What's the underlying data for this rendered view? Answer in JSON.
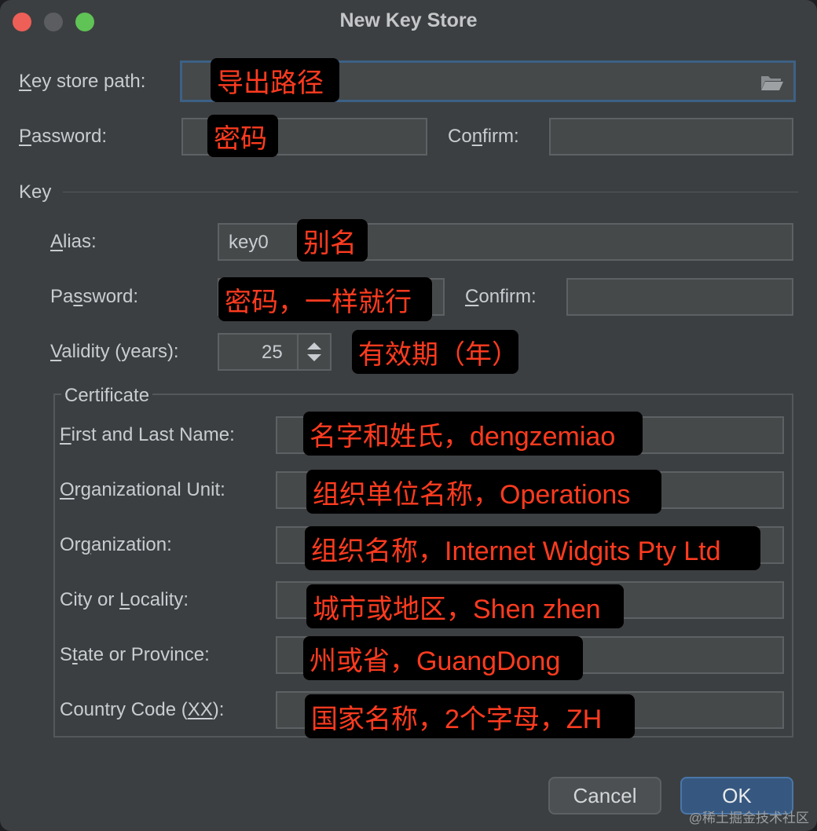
{
  "window": {
    "title": "New Key Store"
  },
  "keystore": {
    "path_label": "Key store path:",
    "path_mnemonic": "K",
    "path_rest": "ey store path:",
    "password_mnemonic": "P",
    "password_rest": "assword:",
    "confirm_pre": "Co",
    "confirm_mnemonic": "n",
    "confirm_rest": "firm:"
  },
  "key_section": {
    "title": "Key",
    "alias_mnemonic": "A",
    "alias_rest": "lias:",
    "alias_value": "key0",
    "password_pre": "Pa",
    "password_mnemonic": "s",
    "password_rest": "sword:",
    "confirm_mnemonic": "C",
    "confirm_rest": "onfirm:",
    "validity_mnemonic": "V",
    "validity_rest": "alidity (years):",
    "validity_value": "25"
  },
  "certificate": {
    "title": "Certificate",
    "first_last_mnemonic": "F",
    "first_last_rest": "irst and Last Name:",
    "org_unit_mnemonic": "O",
    "org_unit_rest": "rganizational Unit:",
    "org_pre": "Or",
    "org_mnemonic": "g",
    "org_rest": "anization:",
    "city_pre": "City or ",
    "city_mnemonic": "L",
    "city_rest": "ocality:",
    "state_pre": "S",
    "state_mnemonic": "t",
    "state_rest": "ate or Province:",
    "country_pre": "Country Code (",
    "country_mnemonic": "XX",
    "country_rest": "):"
  },
  "annotations": {
    "path": "导出路径",
    "password": "密码",
    "alias": "别名",
    "key_password": "密码，一样就行",
    "validity": "有效期（年）",
    "first_last": "名字和姓氏，dengzemiao",
    "org_unit": "组织单位名称，Operations",
    "org": "组织名称，Internet Widgits Pty Ltd",
    "city": "城市或地区，Shen zhen",
    "state": "州或省，GuangDong",
    "country": "国家名称，2个字母，ZH"
  },
  "buttons": {
    "cancel": "Cancel",
    "ok": "OK"
  },
  "watermark": "@稀土掘金技术社区",
  "colors": {
    "annotation_text": "#ff3b1f",
    "ok_button": "#365880",
    "background": "#3c3f41"
  },
  "icons": {
    "folder": "folder-open-icon",
    "spinner": "spinner-arrows-icon"
  }
}
